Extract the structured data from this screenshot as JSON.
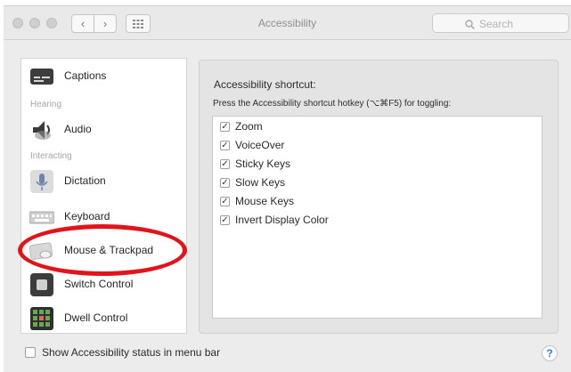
{
  "window": {
    "title": "Accessibility",
    "back_glyph": "‹",
    "forward_glyph": "›",
    "grid_icon": "grid-icon"
  },
  "search": {
    "placeholder": "Search",
    "icon": "magnifier-icon"
  },
  "sidebar": {
    "items": [
      {
        "label": "Captions",
        "icon": "captions-icon"
      },
      {
        "section": "Hearing"
      },
      {
        "label": "Audio",
        "icon": "speaker-icon"
      },
      {
        "section": "Interacting"
      },
      {
        "label": "Dictation",
        "icon": "microphone-icon"
      },
      {
        "label": "Keyboard",
        "icon": "keyboard-icon"
      },
      {
        "label": "Mouse & Trackpad",
        "icon": "mouse-icon"
      },
      {
        "label": "Switch Control",
        "icon": "switch-control-icon"
      },
      {
        "label": "Dwell Control",
        "icon": "dwell-control-icon"
      }
    ]
  },
  "main": {
    "title": "Accessibility shortcut:",
    "subtitle": "Press the Accessibility shortcut hotkey (⌥⌘F5) for toggling:",
    "options": [
      {
        "label": "Zoom",
        "checked": true
      },
      {
        "label": "VoiceOver",
        "checked": true
      },
      {
        "label": "Sticky Keys",
        "checked": true
      },
      {
        "label": "Slow Keys",
        "checked": true
      },
      {
        "label": "Mouse Keys",
        "checked": true
      },
      {
        "label": "Invert Display Color",
        "checked": true
      }
    ]
  },
  "footer": {
    "status_label": "Show Accessibility status in menu bar",
    "status_checked": false,
    "help_glyph": "?"
  },
  "annotation": {
    "color": "#e1141c",
    "target": "Mouse & Trackpad"
  }
}
